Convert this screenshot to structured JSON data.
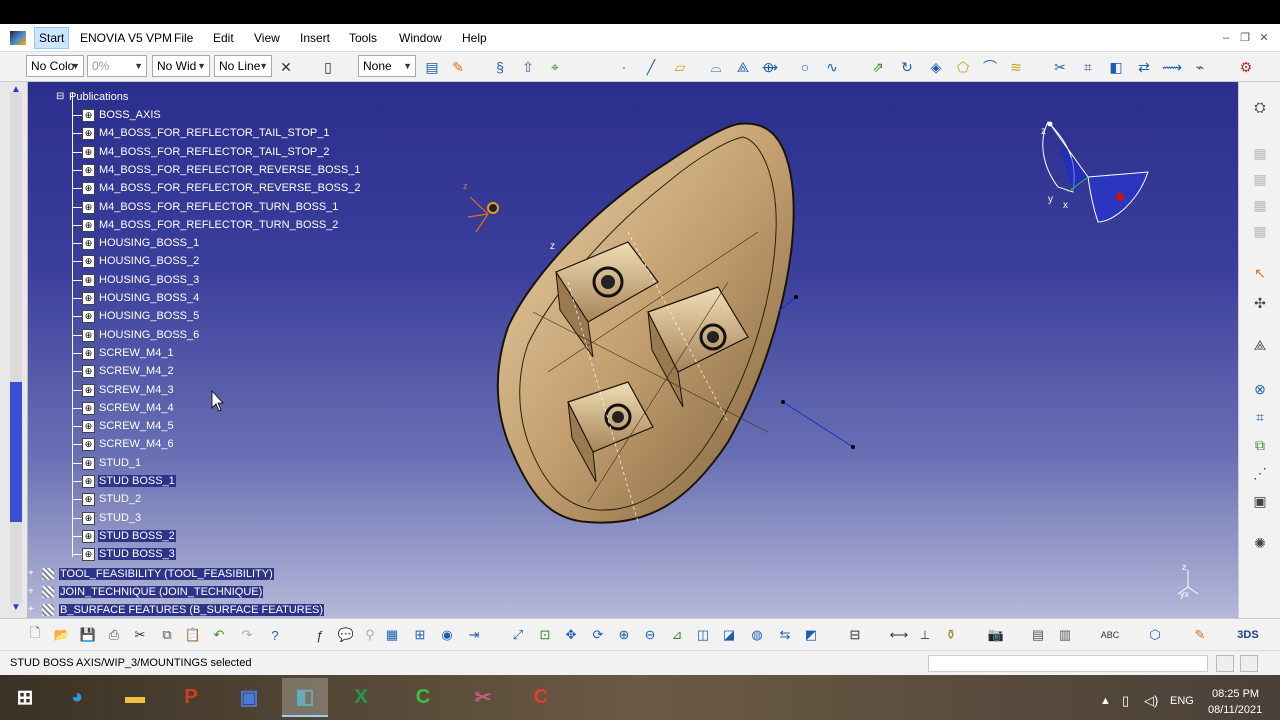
{
  "menubar": {
    "items": [
      "Start",
      "ENOVIA V5 VPM",
      "File",
      "Edit",
      "View",
      "Insert",
      "Tools",
      "Window",
      "Help"
    ],
    "window_controls": [
      "–",
      "❐",
      "✕"
    ]
  },
  "toolbar_top": {
    "color_combo": "No Colo",
    "transparency_combo": "0%",
    "line_width_combo": "No Wid",
    "line_type_combo": "No Line",
    "layer_combo": "None"
  },
  "tree": {
    "publications_label": "Publications",
    "publications": [
      "BOSS_AXIS",
      "M4_BOSS_FOR_REFLECTOR_TAIL_STOP_1",
      "M4_BOSS_FOR_REFLECTOR_TAIL_STOP_2",
      "M4_BOSS_FOR_REFLECTOR_REVERSE_BOSS_1",
      "M4_BOSS_FOR_REFLECTOR_REVERSE_BOSS_2",
      "M4_BOSS_FOR_REFLECTOR_TURN_BOSS_1",
      "M4_BOSS_FOR_REFLECTOR_TURN_BOSS_2",
      "HOUSING_BOSS_1",
      "HOUSING_BOSS_2",
      "HOUSING_BOSS_3",
      "HOUSING_BOSS_4",
      "HOUSING_BOSS_5",
      "HOUSING_BOSS_6",
      "SCREW_M4_1",
      "SCREW_M4_2",
      "SCREW_M4_3",
      "SCREW_M4_4",
      "SCREW_M4_5",
      "SCREW_M4_6",
      "STUD_1",
      "STUD BOSS_1",
      "STUD_2",
      "STUD_3",
      "STUD BOSS_2",
      "STUD BOSS_3"
    ],
    "selected_indices": [
      20,
      23,
      24
    ],
    "nodes": [
      "TOOL_FEASIBILITY (TOOL_FEASIBILITY)",
      "JOIN_TECHNIQUE (JOIN_TECHNIQUE)",
      "B_SURFACE FEATURES (B_SURFACE FEATURES)"
    ]
  },
  "viewport": {
    "axis_labels": {
      "z": "z",
      "x": "x",
      "y": "y",
      "small_axis": "z",
      "small_axis_yx": "yx"
    }
  },
  "status": {
    "text": "STUD BOSS AXIS/WIP_3/MOUNTINGS selected"
  },
  "taskbar": {
    "tray_lang": "ENG",
    "time": "08:25 PM",
    "date": "08/11/2021"
  },
  "colors": {
    "viewport_top": "#2b2e8c",
    "viewport_bottom": "#b5b8d8",
    "model": "#c8a878",
    "selection": "#2d348a"
  },
  "icons": {
    "top_toolbar": [
      "no-fill-icon",
      "paintbrush-icon",
      "sketch-icon",
      "pad-icon",
      "axis-icon",
      "point-icon",
      "line-icon",
      "plane-icon",
      "projection-icon",
      "intersection-icon",
      "offset-icon",
      "circle-icon",
      "spline-icon",
      "extrude-icon",
      "revolve-icon",
      "sweep-icon",
      "fill-icon",
      "blend-icon",
      "join-icon",
      "split-icon",
      "trim-icon",
      "fillet-icon",
      "transform-icon",
      "extrapolate-icon",
      "catia-app-icon"
    ],
    "bottom_toolbar": [
      "new-icon",
      "open-icon",
      "save-icon",
      "print-icon",
      "cut-icon",
      "copy-icon",
      "paste-icon",
      "undo-icon",
      "redo-icon",
      "help-icon",
      "formula-icon",
      "comment-icon",
      "table-icon",
      "graph-icon",
      "sphere-icon",
      "split-view-icon",
      "fly-icon",
      "fit-all-icon",
      "pan-icon",
      "rotate-icon",
      "zoom-in-icon",
      "zoom-out-icon",
      "normal-view-icon",
      "iso-view-icon",
      "view-mode-icon",
      "hide-show-icon",
      "swap-icon",
      "measure-icon",
      "cache-icon",
      "snapshot-icon",
      "capture-icon",
      "abc-icon",
      "tools-icon",
      "catia-logo-icon"
    ]
  }
}
